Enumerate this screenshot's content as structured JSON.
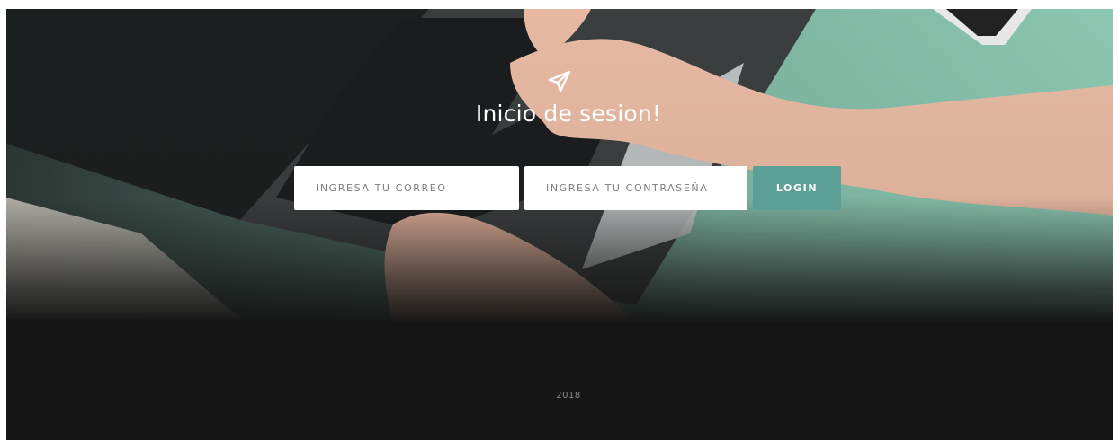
{
  "header": {
    "icon": "paper-plane-icon",
    "title": "Inicio de sesion!"
  },
  "form": {
    "email_placeholder": "INGRESA TU CORREO",
    "email_value": "",
    "password_placeholder": "INGRESA TU CONTRASEÑA",
    "password_value": "",
    "login_label": "LOGIN"
  },
  "footer": {
    "year": "2018"
  },
  "colors": {
    "accent": "#5c9f97",
    "footer_bg": "#161616",
    "title_text": "#ffffff"
  }
}
